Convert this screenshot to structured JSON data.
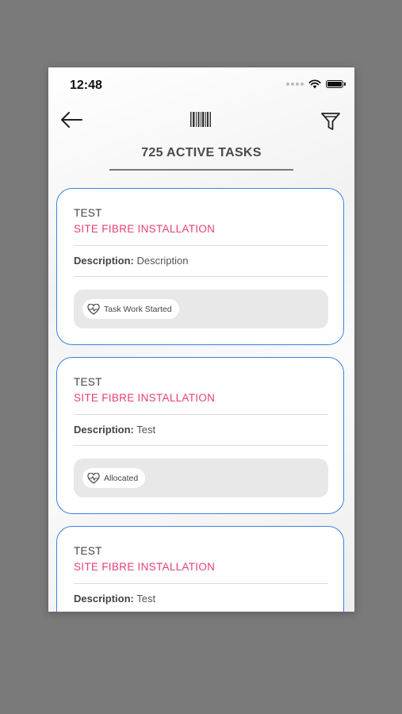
{
  "status_bar": {
    "time": "12:48"
  },
  "header": {
    "title": "725 ACTIVE TASKS"
  },
  "icons": {
    "back": "arrow-left-icon",
    "barcode": "barcode-icon",
    "filter": "funnel-icon",
    "status": "heart-pulse-icon"
  },
  "colors": {
    "card_border": "#3f7fe6",
    "task_type": "#e5407a",
    "background": "#7a7a7a"
  },
  "tasks": [
    {
      "name": "TEST",
      "type": "SITE FIBRE INSTALLATION",
      "description_label": "Description:",
      "description": "Description",
      "status": "Task Work Started"
    },
    {
      "name": "TEST",
      "type": "SITE FIBRE INSTALLATION",
      "description_label": "Description:",
      "description": "Test",
      "status": "Allocated"
    },
    {
      "name": "TEST",
      "type": "SITE FIBRE INSTALLATION",
      "description_label": "Description:",
      "description": "Test",
      "status": ""
    }
  ]
}
